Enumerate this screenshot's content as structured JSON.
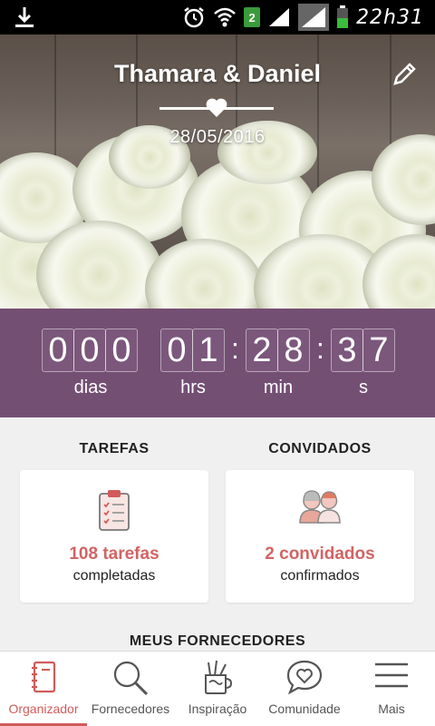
{
  "status_bar": {
    "time": "22h31",
    "notification_count": "2"
  },
  "header": {
    "title": "Thamara & Daniel",
    "date": "28/05/2016"
  },
  "countdown": {
    "days": [
      "0",
      "0",
      "0"
    ],
    "hours": [
      "0",
      "1"
    ],
    "minutes": [
      "2",
      "8"
    ],
    "seconds": [
      "3",
      "7"
    ],
    "labels": {
      "days": "dias",
      "hours": "hrs",
      "minutes": "min",
      "seconds": "s"
    }
  },
  "sections": {
    "tasks": {
      "title": "TAREFAS",
      "count": "108 tarefas",
      "sub": "completadas"
    },
    "guests": {
      "title": "CONVIDADOS",
      "count": "2 convidados",
      "sub": "confirmados"
    },
    "vendors_title": "MEUS FORNECEDORES"
  },
  "nav": [
    {
      "label": "Organizador",
      "icon": "notebook-icon",
      "active": true
    },
    {
      "label": "Fornecedores",
      "icon": "search-icon",
      "active": false
    },
    {
      "label": "Inspiração",
      "icon": "pencil-cup-icon",
      "active": false
    },
    {
      "label": "Comunidade",
      "icon": "chat-heart-icon",
      "active": false
    },
    {
      "label": "Mais",
      "icon": "menu-icon",
      "active": false
    }
  ],
  "colors": {
    "accent": "#d25a5a",
    "countdown_bg": "#744f74"
  }
}
